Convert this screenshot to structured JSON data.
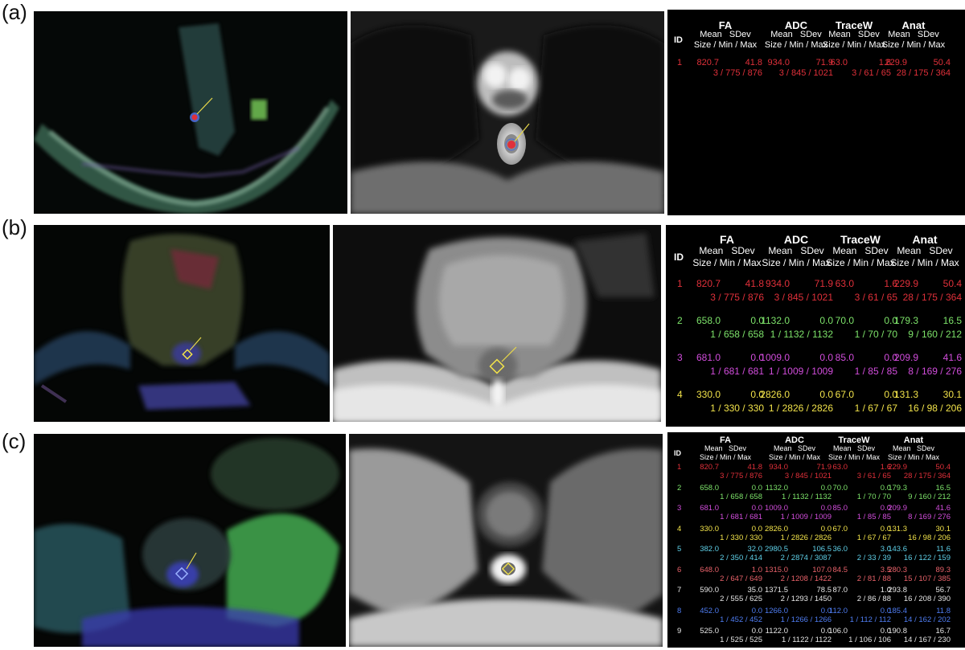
{
  "panels": [
    {
      "label": "(a)",
      "rows_visible": 1
    },
    {
      "label": "(b)",
      "rows_visible": 4
    },
    {
      "label": "(c)",
      "rows_visible": 9
    }
  ],
  "table": {
    "id_header": "ID",
    "groups": [
      {
        "name": "FA",
        "sub1": "Mean   SDev",
        "sub2": "Size / Min / Max"
      },
      {
        "name": "ADC",
        "sub1": "Mean   SDev",
        "sub2": "Size / Min / Max"
      },
      {
        "name": "TraceW",
        "sub1": "Mean   SDev",
        "sub2": "Size / Min / Max"
      },
      {
        "name": "Anat",
        "sub1": "Mean   SDev",
        "sub2": "Size / Min / Max"
      }
    ],
    "rows": [
      {
        "id": "1",
        "color": "#e0303a",
        "fa": [
          "820.7",
          "41.8",
          "3 / 775 / 876"
        ],
        "adc": [
          "934.0",
          "71.9",
          "3 / 845 / 1021"
        ],
        "tw": [
          "63.0",
          "1.6",
          "3 / 61 / 65"
        ],
        "an": [
          "229.9",
          "50.4",
          "28 / 175 / 364"
        ]
      },
      {
        "id": "2",
        "color": "#7de36a",
        "fa": [
          "658.0",
          "0.0",
          "1 / 658 / 658"
        ],
        "adc": [
          "1132.0",
          "0.0",
          "1 / 1132 / 1132"
        ],
        "tw": [
          "70.0",
          "0.0",
          "1 / 70 / 70"
        ],
        "an": [
          "179.3",
          "16.5",
          "9 / 160 / 212"
        ]
      },
      {
        "id": "3",
        "color": "#d24ddc",
        "fa": [
          "681.0",
          "0.0",
          "1 / 681 / 681"
        ],
        "adc": [
          "1009.0",
          "0.0",
          "1 / 1009 / 1009"
        ],
        "tw": [
          "85.0",
          "0.0",
          "1 / 85 / 85"
        ],
        "an": [
          "209.9",
          "41.6",
          "8 / 169 / 276"
        ]
      },
      {
        "id": "4",
        "color": "#f2e34a",
        "fa": [
          "330.0",
          "0.0",
          "1 / 330 / 330"
        ],
        "adc": [
          "2826.0",
          "0.0",
          "1 / 2826 / 2826"
        ],
        "tw": [
          "67.0",
          "0.0",
          "1 / 67 / 67"
        ],
        "an": [
          "131.3",
          "30.1",
          "16 / 98 / 206"
        ]
      },
      {
        "id": "5",
        "color": "#5fd0e8",
        "fa": [
          "382.0",
          "32.0",
          "2 / 350 / 414"
        ],
        "adc": [
          "2980.5",
          "106.5",
          "2 / 2874 / 3087"
        ],
        "tw": [
          "36.0",
          "3.0",
          "2 / 33 / 39"
        ],
        "an": [
          "143.6",
          "11.6",
          "16 / 122 / 159"
        ]
      },
      {
        "id": "6",
        "color": "#e8626a",
        "fa": [
          "648.0",
          "1.0",
          "2 / 647 / 649"
        ],
        "adc": [
          "1315.0",
          "107.0",
          "2 / 1208 / 1422"
        ],
        "tw": [
          "84.5",
          "3.5",
          "2 / 81 / 88"
        ],
        "an": [
          "280.3",
          "89.3",
          "15 / 107 / 385"
        ]
      },
      {
        "id": "7",
        "color": "#e6e6e6",
        "fa": [
          "590.0",
          "35.0",
          "2 / 555 / 625"
        ],
        "adc": [
          "1371.5",
          "78.5",
          "2 / 1293 / 1450"
        ],
        "tw": [
          "87.0",
          "1.0",
          "2 / 86 / 88"
        ],
        "an": [
          "293.8",
          "56.7",
          "16 / 208 / 390"
        ]
      },
      {
        "id": "8",
        "color": "#4f7df2",
        "fa": [
          "452.0",
          "0.0",
          "1 / 452 / 452"
        ],
        "adc": [
          "1266.0",
          "0.0",
          "1 / 1266 / 1266"
        ],
        "tw": [
          "112.0",
          "0.0",
          "1 / 112 / 112"
        ],
        "an": [
          "185.4",
          "11.8",
          "14 / 162 / 202"
        ]
      },
      {
        "id": "9",
        "color": "#e6e6e6",
        "fa": [
          "525.0",
          "0.0",
          "1 / 525 / 525"
        ],
        "adc": [
          "1122.0",
          "0.0",
          "1 / 1122 / 1122"
        ],
        "tw": [
          "106.0",
          "0.0",
          "1 / 106 / 106"
        ],
        "an": [
          "190.8",
          "16.7",
          "14 / 167 / 230"
        ]
      }
    ]
  },
  "colors": {
    "background": "#ffffff",
    "table_bg": "#000000",
    "roi_red": "#e0303a",
    "roi_yellow": "#f2e34a",
    "roi_blue": "#7fa8ff"
  }
}
